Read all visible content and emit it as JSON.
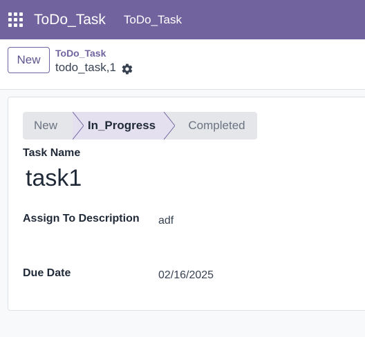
{
  "colors": {
    "brand": "#71639e",
    "statusbar_active": "#e5e0f0",
    "statusbar_inactive": "#e4e6ea"
  },
  "topbar": {
    "apps_icon": "grid-icon",
    "app_title": "ToDo_Task",
    "menu_item": "ToDo_Task"
  },
  "control_panel": {
    "new_label": "New",
    "breadcrumb": "ToDo_Task",
    "record_name": "todo_task,1",
    "settings_icon": "gear-icon"
  },
  "statusbar": {
    "stages": [
      "New",
      "In_Progress",
      "Completed"
    ],
    "active": "In_Progress"
  },
  "form": {
    "task_name_label": "Task Name",
    "task_name_value": "task1",
    "assign_label": "Assign To Description",
    "assign_value": "adf",
    "due_date_label": "Due Date",
    "due_date_value": "02/16/2025"
  }
}
